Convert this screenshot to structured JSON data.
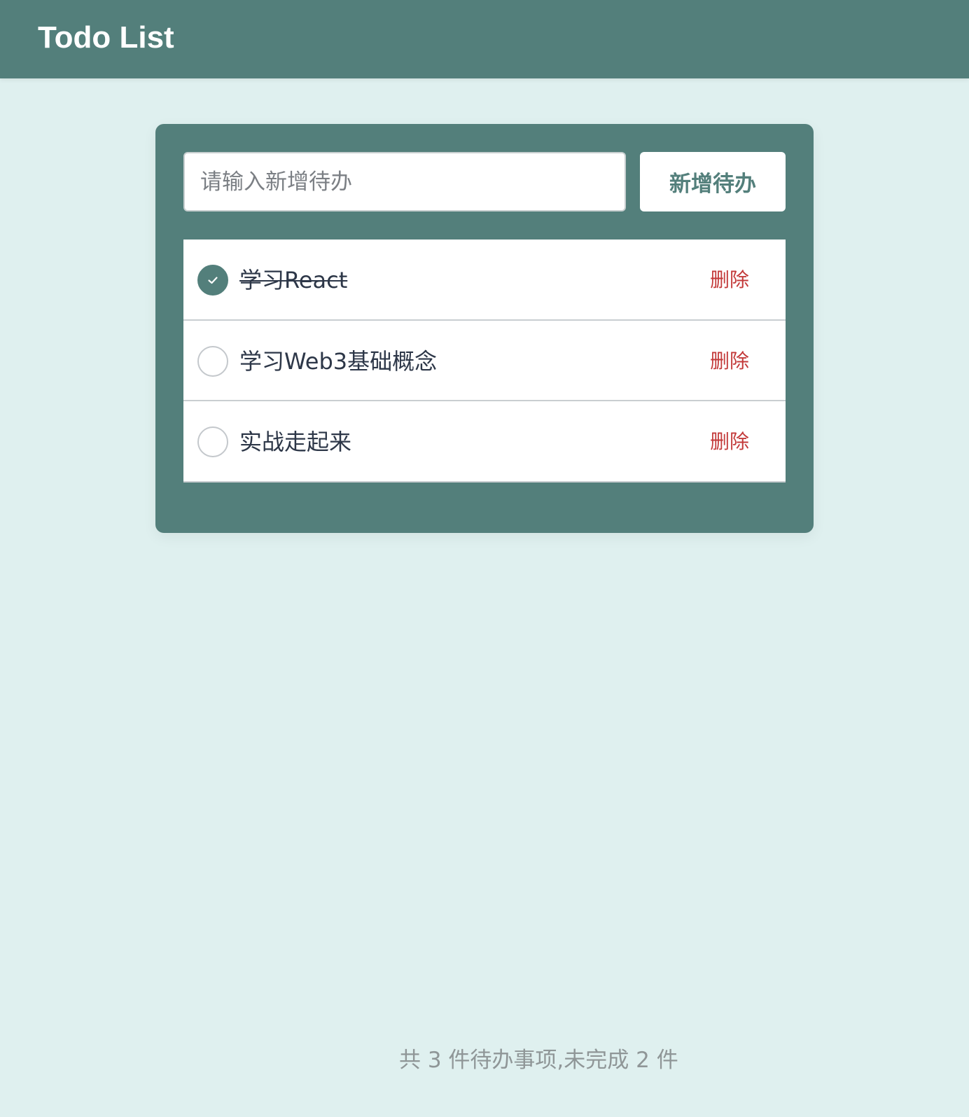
{
  "header": {
    "title": "Todo List"
  },
  "new_todo": {
    "placeholder": "请输入新增待办",
    "value": "",
    "add_label": "新增待办"
  },
  "todos": [
    {
      "text": "学习React",
      "completed": true,
      "delete_label": "删除"
    },
    {
      "text": "学习Web3基础概念",
      "completed": false,
      "delete_label": "删除"
    },
    {
      "text": "实战走起来",
      "completed": false,
      "delete_label": "删除"
    }
  ],
  "footer": {
    "summary": "共 3 件待办事项,未完成 2 件"
  },
  "colors": {
    "primary": "#537f7b",
    "background": "#dff0ef",
    "danger": "#c33a3a"
  },
  "icons": {
    "checked": "check-icon"
  }
}
